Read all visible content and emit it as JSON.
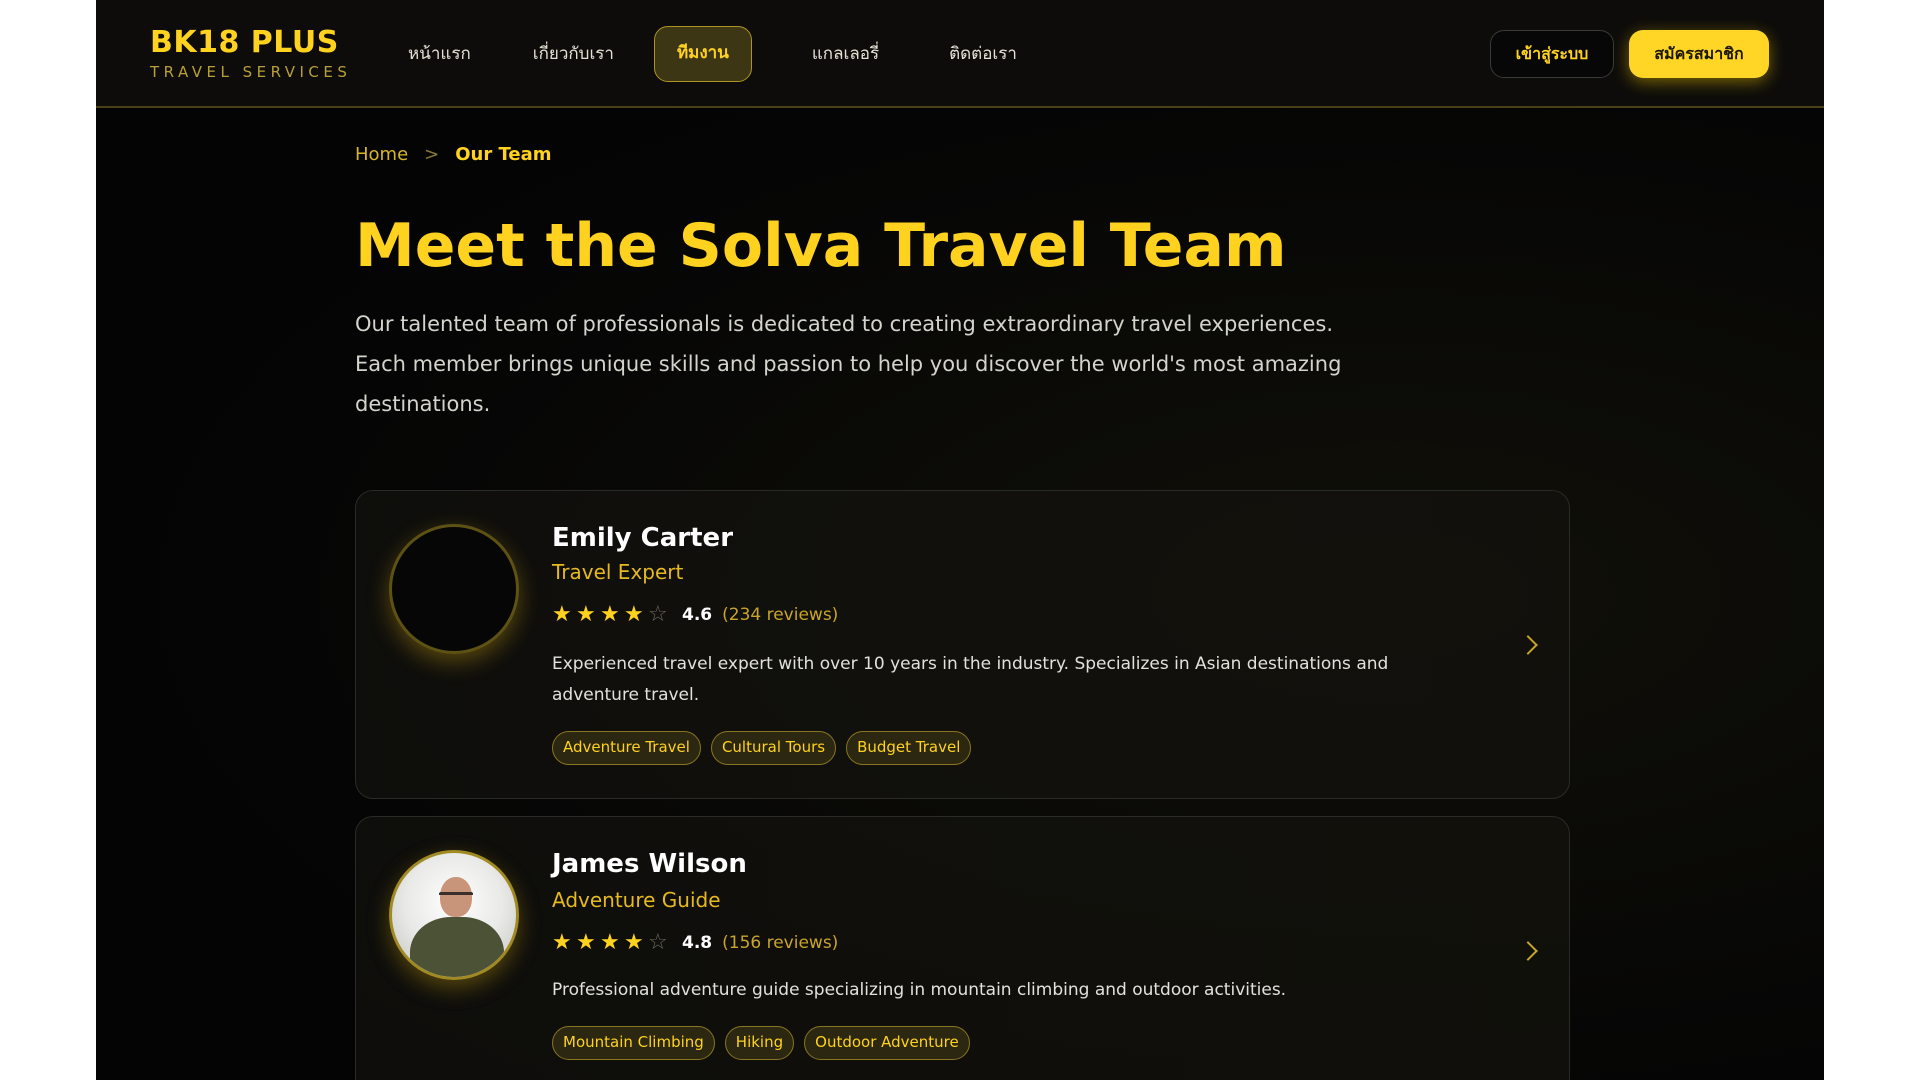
{
  "brand": {
    "title": "BK18 PLUS",
    "subtitle": "TRAVEL SERVICES"
  },
  "nav": {
    "items": [
      {
        "label": "หน้าแรก"
      },
      {
        "label": "เกี่ยวกับเรา"
      },
      {
        "label": "ทีมงาน",
        "active": true
      },
      {
        "label": "แกลเลอรี่"
      },
      {
        "label": "ติดต่อเรา"
      }
    ],
    "login_label": "เข้าสู่ระบบ",
    "signup_label": "สมัครสมาชิก"
  },
  "breadcrumb": {
    "home": "Home",
    "separator": ">",
    "current": "Our Team"
  },
  "page": {
    "title": "Meet the Solva Travel Team",
    "intro": "Our talented team of professionals is dedicated to creating extraordinary travel experiences. Each member brings unique skills and passion to help you discover the world's most amazing destinations."
  },
  "team": [
    {
      "name": "Emily Carter",
      "role": "Travel Expert",
      "stars_filled": 4,
      "stars_total": 5,
      "rating": "4.6",
      "reviews": "(234 reviews)",
      "bio": "Experienced travel expert with over 10 years in the industry. Specializes in Asian destinations and adventure travel.",
      "tags": [
        "Adventure Travel",
        "Cultural Tours",
        "Budget Travel"
      ],
      "has_photo": false
    },
    {
      "name": "James Wilson",
      "role": "Adventure Guide",
      "stars_filled": 4,
      "stars_total": 5,
      "rating": "4.8",
      "reviews": "(156 reviews)",
      "bio": "Professional adventure guide specializing in mountain climbing and outdoor activities.",
      "tags": [
        "Mountain Climbing",
        "Hiking",
        "Outdoor Adventure"
      ],
      "has_photo": true
    }
  ],
  "icons": {
    "star": "star-icon",
    "chevron": "chevron-right-icon"
  },
  "colors": {
    "accent": "#ffd21f",
    "background": "#050505",
    "card_border": "#2a2a26"
  }
}
